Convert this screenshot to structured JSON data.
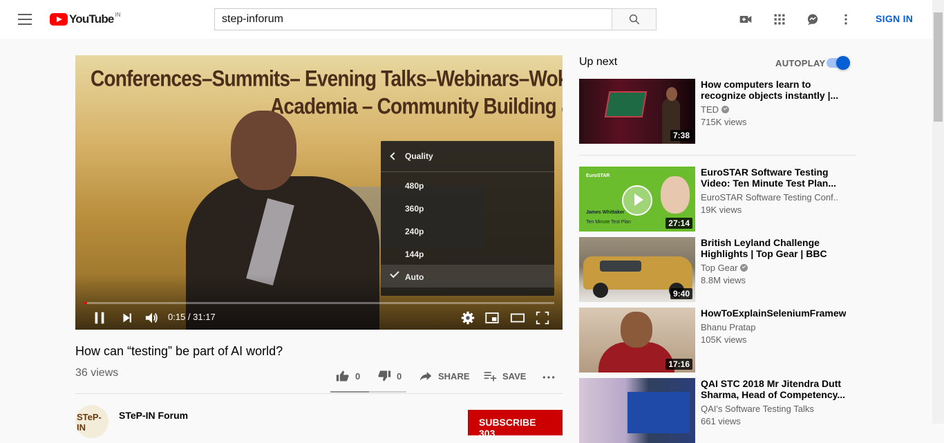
{
  "header": {
    "logo_text": "YouTube",
    "logo_country": "IN",
    "search_value": "step-inforum",
    "signin_label": "SIGN IN"
  },
  "player": {
    "banner_line1": "Conferences–Summits– Evening Talks–Webinars–Wokshops–T",
    "banner_line2": "Academia – Community Building & Eng",
    "time": "0:15 / 31:17",
    "progress": 0.008,
    "quality_menu": {
      "title": "Quality",
      "options": [
        "480p",
        "360p",
        "240p",
        "144p",
        "Auto"
      ],
      "selected": "Auto"
    }
  },
  "video": {
    "title": "How can “testing” be part of AI world?",
    "views": "36 views",
    "likes": "0",
    "dislikes": "0",
    "share_label": "SHARE",
    "save_label": "SAVE"
  },
  "channel": {
    "name": "STeP-IN Forum",
    "avatar_text": "STeP-IN",
    "subscribe_label": "SUBSCRIBE  303"
  },
  "sidebar": {
    "up_next": "Up next",
    "autoplay_label": "AUTOPLAY",
    "autoplay_on": true,
    "recommendations": [
      {
        "title": "How computers learn to recognize objects instantly |...",
        "channel": "TED",
        "verified": true,
        "views": "715K views",
        "duration": "7:38"
      },
      {
        "title": "EuroSTAR Software Testing Video: Ten Minute Test Plan...",
        "channel": "EuroSTAR Software Testing Conf...",
        "verified": false,
        "views": "19K views",
        "duration": "27:14",
        "thumb_text1": "EuroSTAR",
        "thumb_text2": "James Whittaker",
        "thumb_text3": "Ten Minute Test Plan"
      },
      {
        "title": "British Leyland Challenge Highlights | Top Gear | BBC",
        "channel": "Top Gear",
        "verified": true,
        "views": "8.8M views",
        "duration": "9:40"
      },
      {
        "title": "HowToExplainSeleniumFramewo",
        "channel": "Bhanu Pratap",
        "verified": false,
        "views": "105K views",
        "duration": "17:16"
      },
      {
        "title": "QAI STC 2018 Mr Jitendra Dutt Sharma, Head of Competency...",
        "channel": "QAI's Software Testing Talks",
        "verified": false,
        "views": "661 views",
        "duration": ""
      }
    ]
  }
}
